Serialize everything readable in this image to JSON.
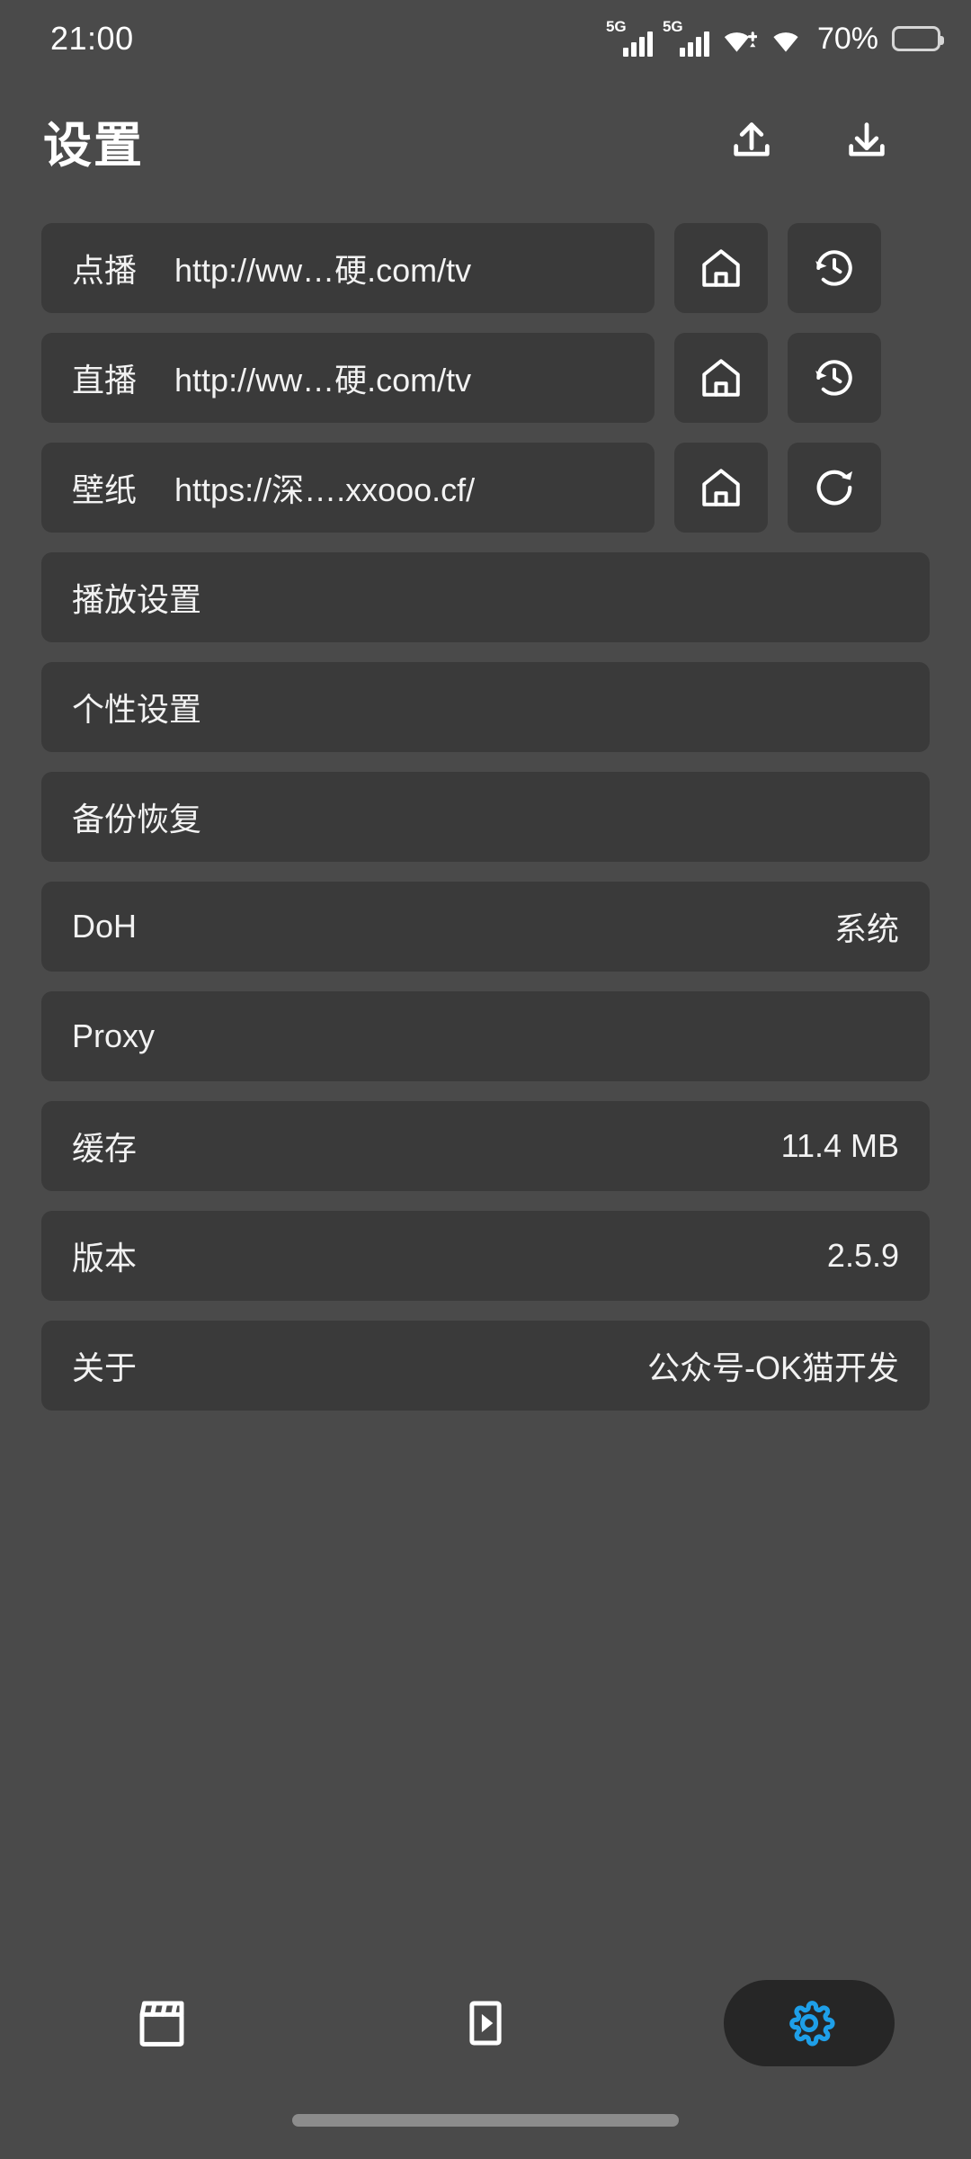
{
  "status_bar": {
    "time": "21:00",
    "signal_1_label": "5G",
    "signal_2_label": "5G",
    "battery_percent": "70%",
    "icons": [
      "signal-5g-icon",
      "signal-5g-icon",
      "wifi-data-icon",
      "wifi-icon",
      "battery-icon"
    ]
  },
  "header": {
    "title": "设置",
    "actions": [
      {
        "name": "export-button",
        "icon": "upload-icon"
      },
      {
        "name": "import-button",
        "icon": "download-icon"
      }
    ]
  },
  "url_rows": [
    {
      "label": "点播",
      "url": "http://ww…硬.com/tv",
      "home_icon": "home-icon",
      "action_icon": "history-icon"
    },
    {
      "label": "直播",
      "url": "http://ww…硬.com/tv",
      "home_icon": "home-icon",
      "action_icon": "history-icon"
    },
    {
      "label": "壁纸",
      "url": "https://深….xxooo.cf/",
      "home_icon": "home-icon",
      "action_icon": "refresh-icon"
    }
  ],
  "setting_rows": [
    {
      "label": "播放设置",
      "value": ""
    },
    {
      "label": "个性设置",
      "value": ""
    },
    {
      "label": "备份恢复",
      "value": ""
    },
    {
      "label": "DoH",
      "value": "系统"
    },
    {
      "label": "Proxy",
      "value": ""
    },
    {
      "label": "缓存",
      "value": "11.4 MB"
    },
    {
      "label": "版本",
      "value": "2.5.9"
    },
    {
      "label": "关于",
      "value": "公众号-OK猫开发"
    }
  ],
  "bottom_nav": [
    {
      "name": "nav-vod",
      "icon": "clapperboard-icon",
      "active": false
    },
    {
      "name": "nav-live",
      "icon": "play-rectangle-icon",
      "active": false
    },
    {
      "name": "nav-settings",
      "icon": "gear-icon",
      "active": true
    }
  ],
  "colors": {
    "page_background": "#4a4a4a",
    "card_background": "#3a3a3a",
    "active_accent": "#1e9fe8",
    "active_pill": "#262626",
    "text_primary": "#f2f2f2"
  }
}
